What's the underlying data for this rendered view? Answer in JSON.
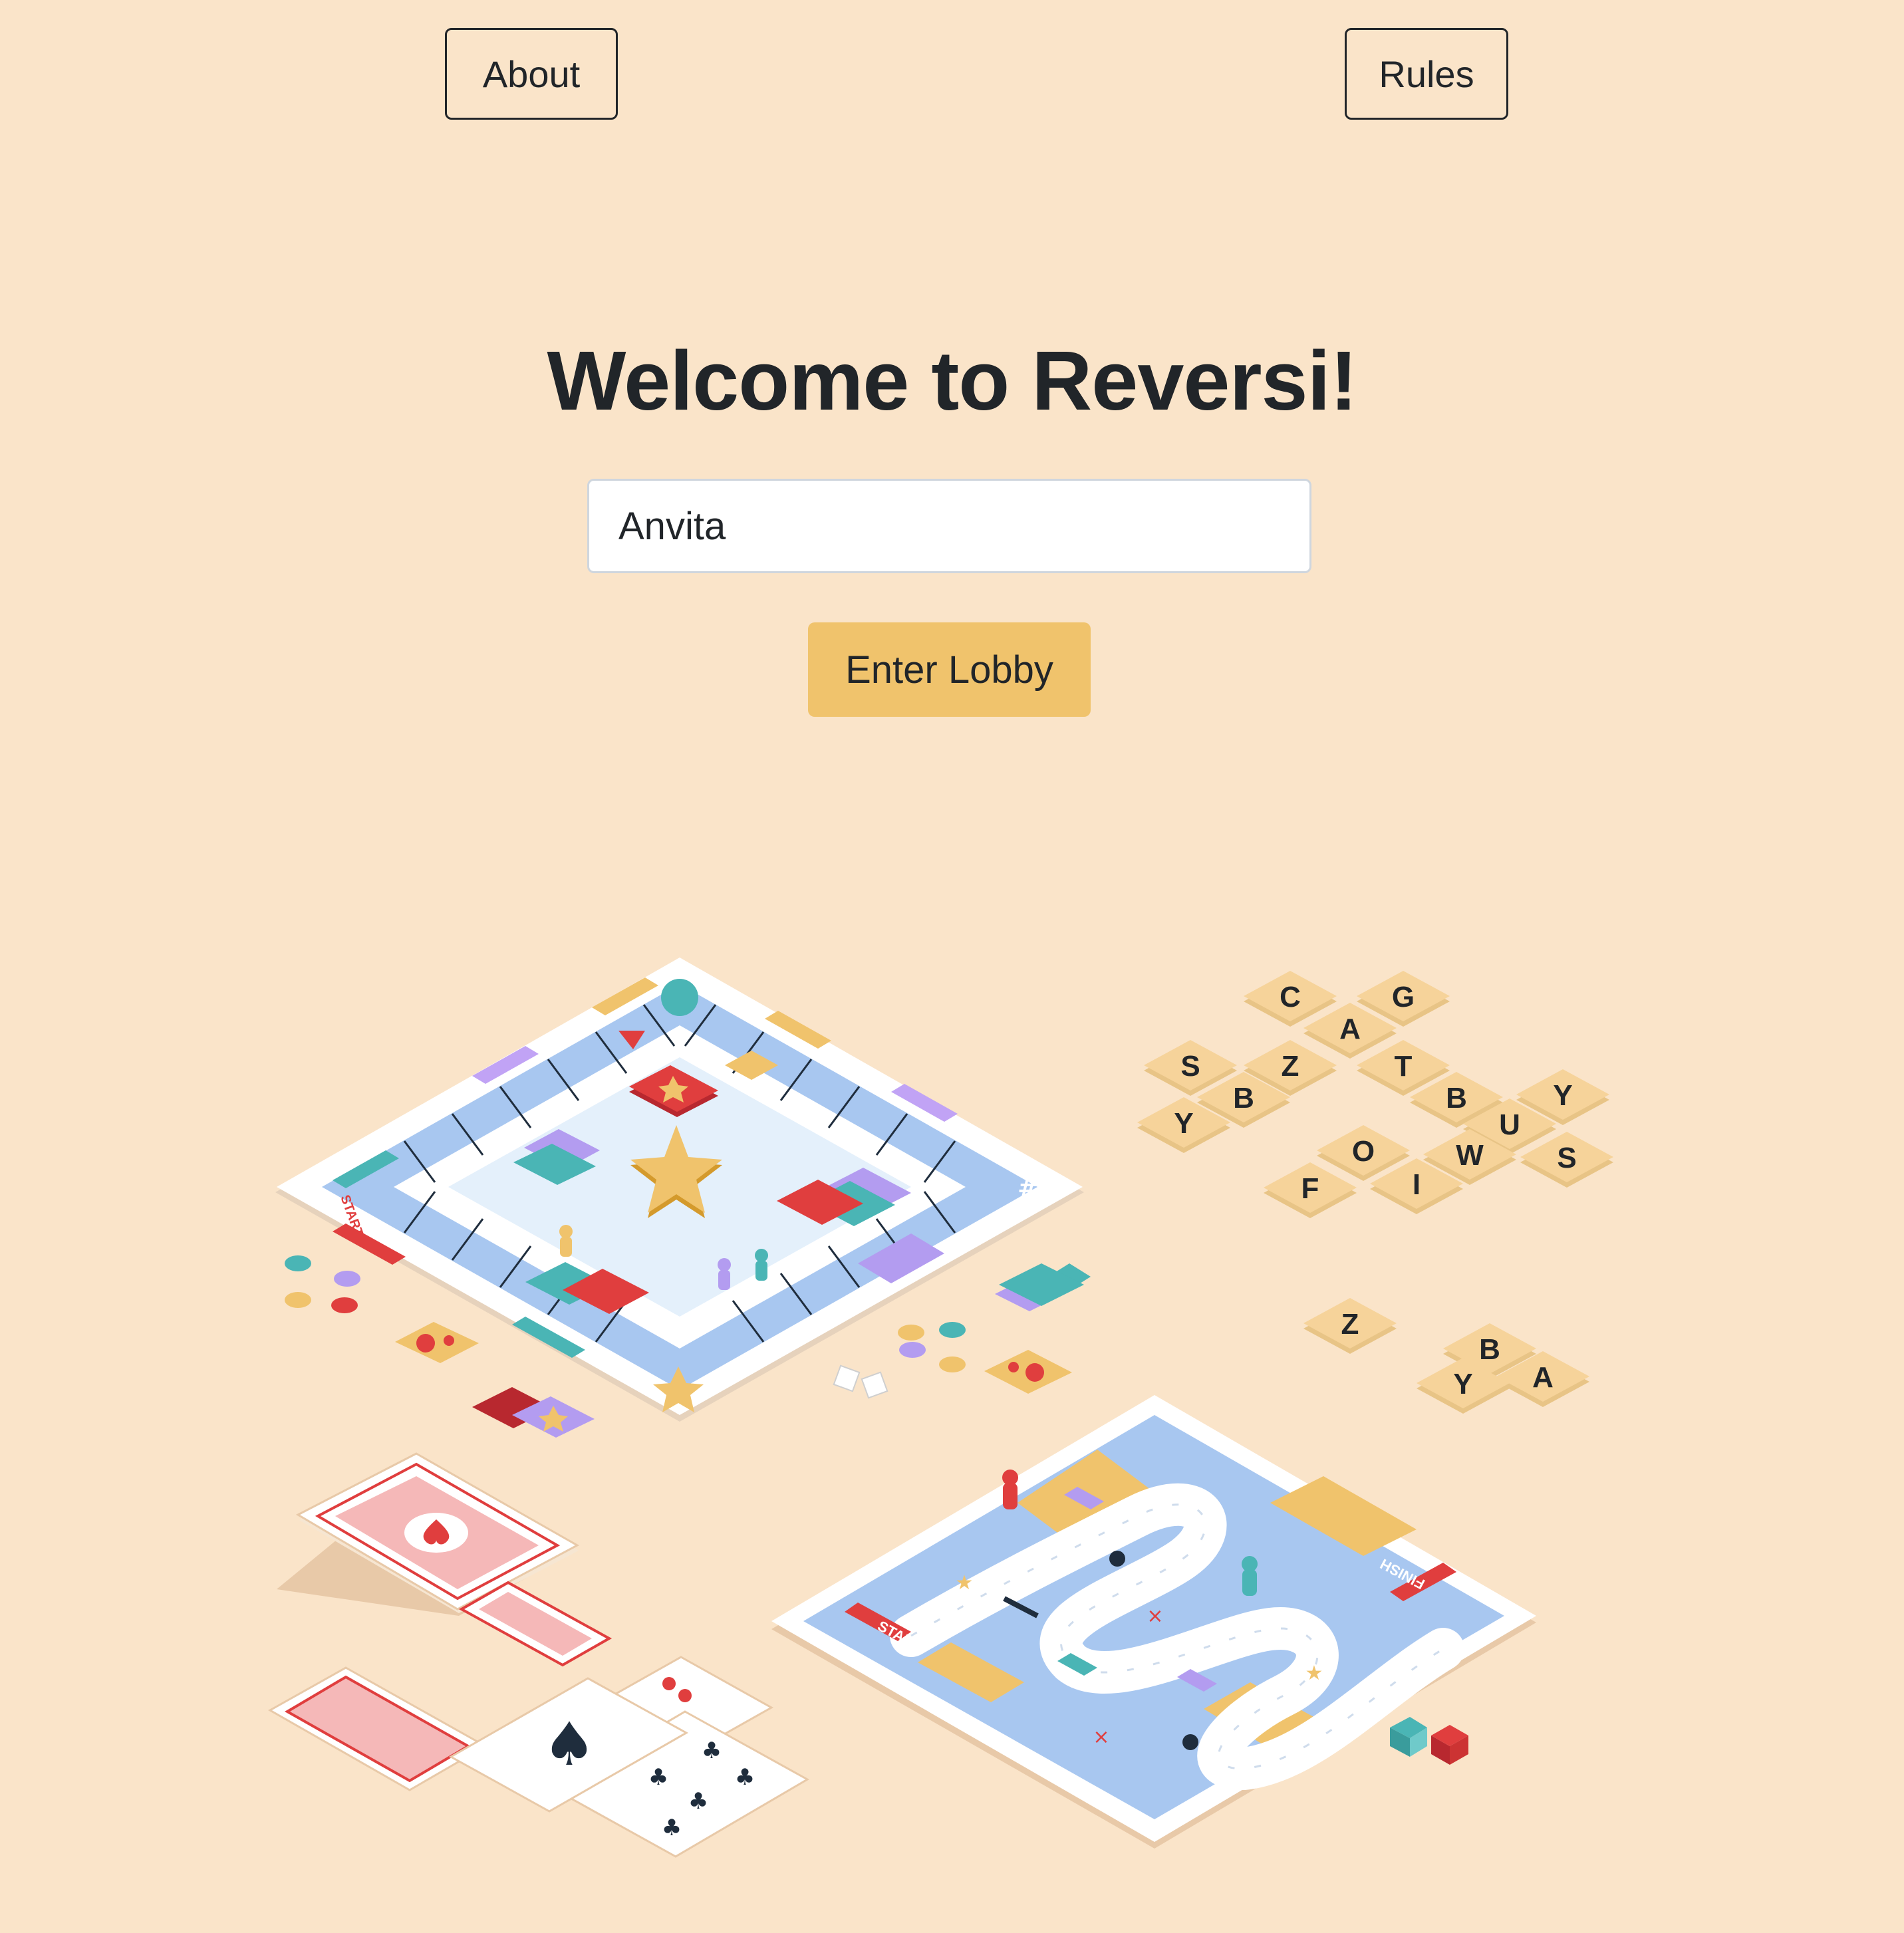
{
  "nav": {
    "about_label": "About",
    "rules_label": "Rules"
  },
  "main": {
    "title": "Welcome to Reversi!",
    "name_input": {
      "value": "Anvita"
    },
    "enter_lobby_label": "Enter Lobby"
  },
  "illustration": {
    "board_start_label": "START",
    "snake_start_label": "START",
    "snake_finish_label": "FINISH",
    "tiles_upper": [
      "C",
      "G",
      "A",
      "S",
      "Z",
      "T",
      "B",
      "Y",
      "Y",
      "B",
      "U",
      "O",
      "W",
      "S",
      "F",
      "I"
    ],
    "tiles_lower": [
      "Z",
      "B",
      "A",
      "Y"
    ]
  },
  "colors": {
    "background": "#fae4c9",
    "accent": "#f0c36c",
    "text": "#212529"
  }
}
